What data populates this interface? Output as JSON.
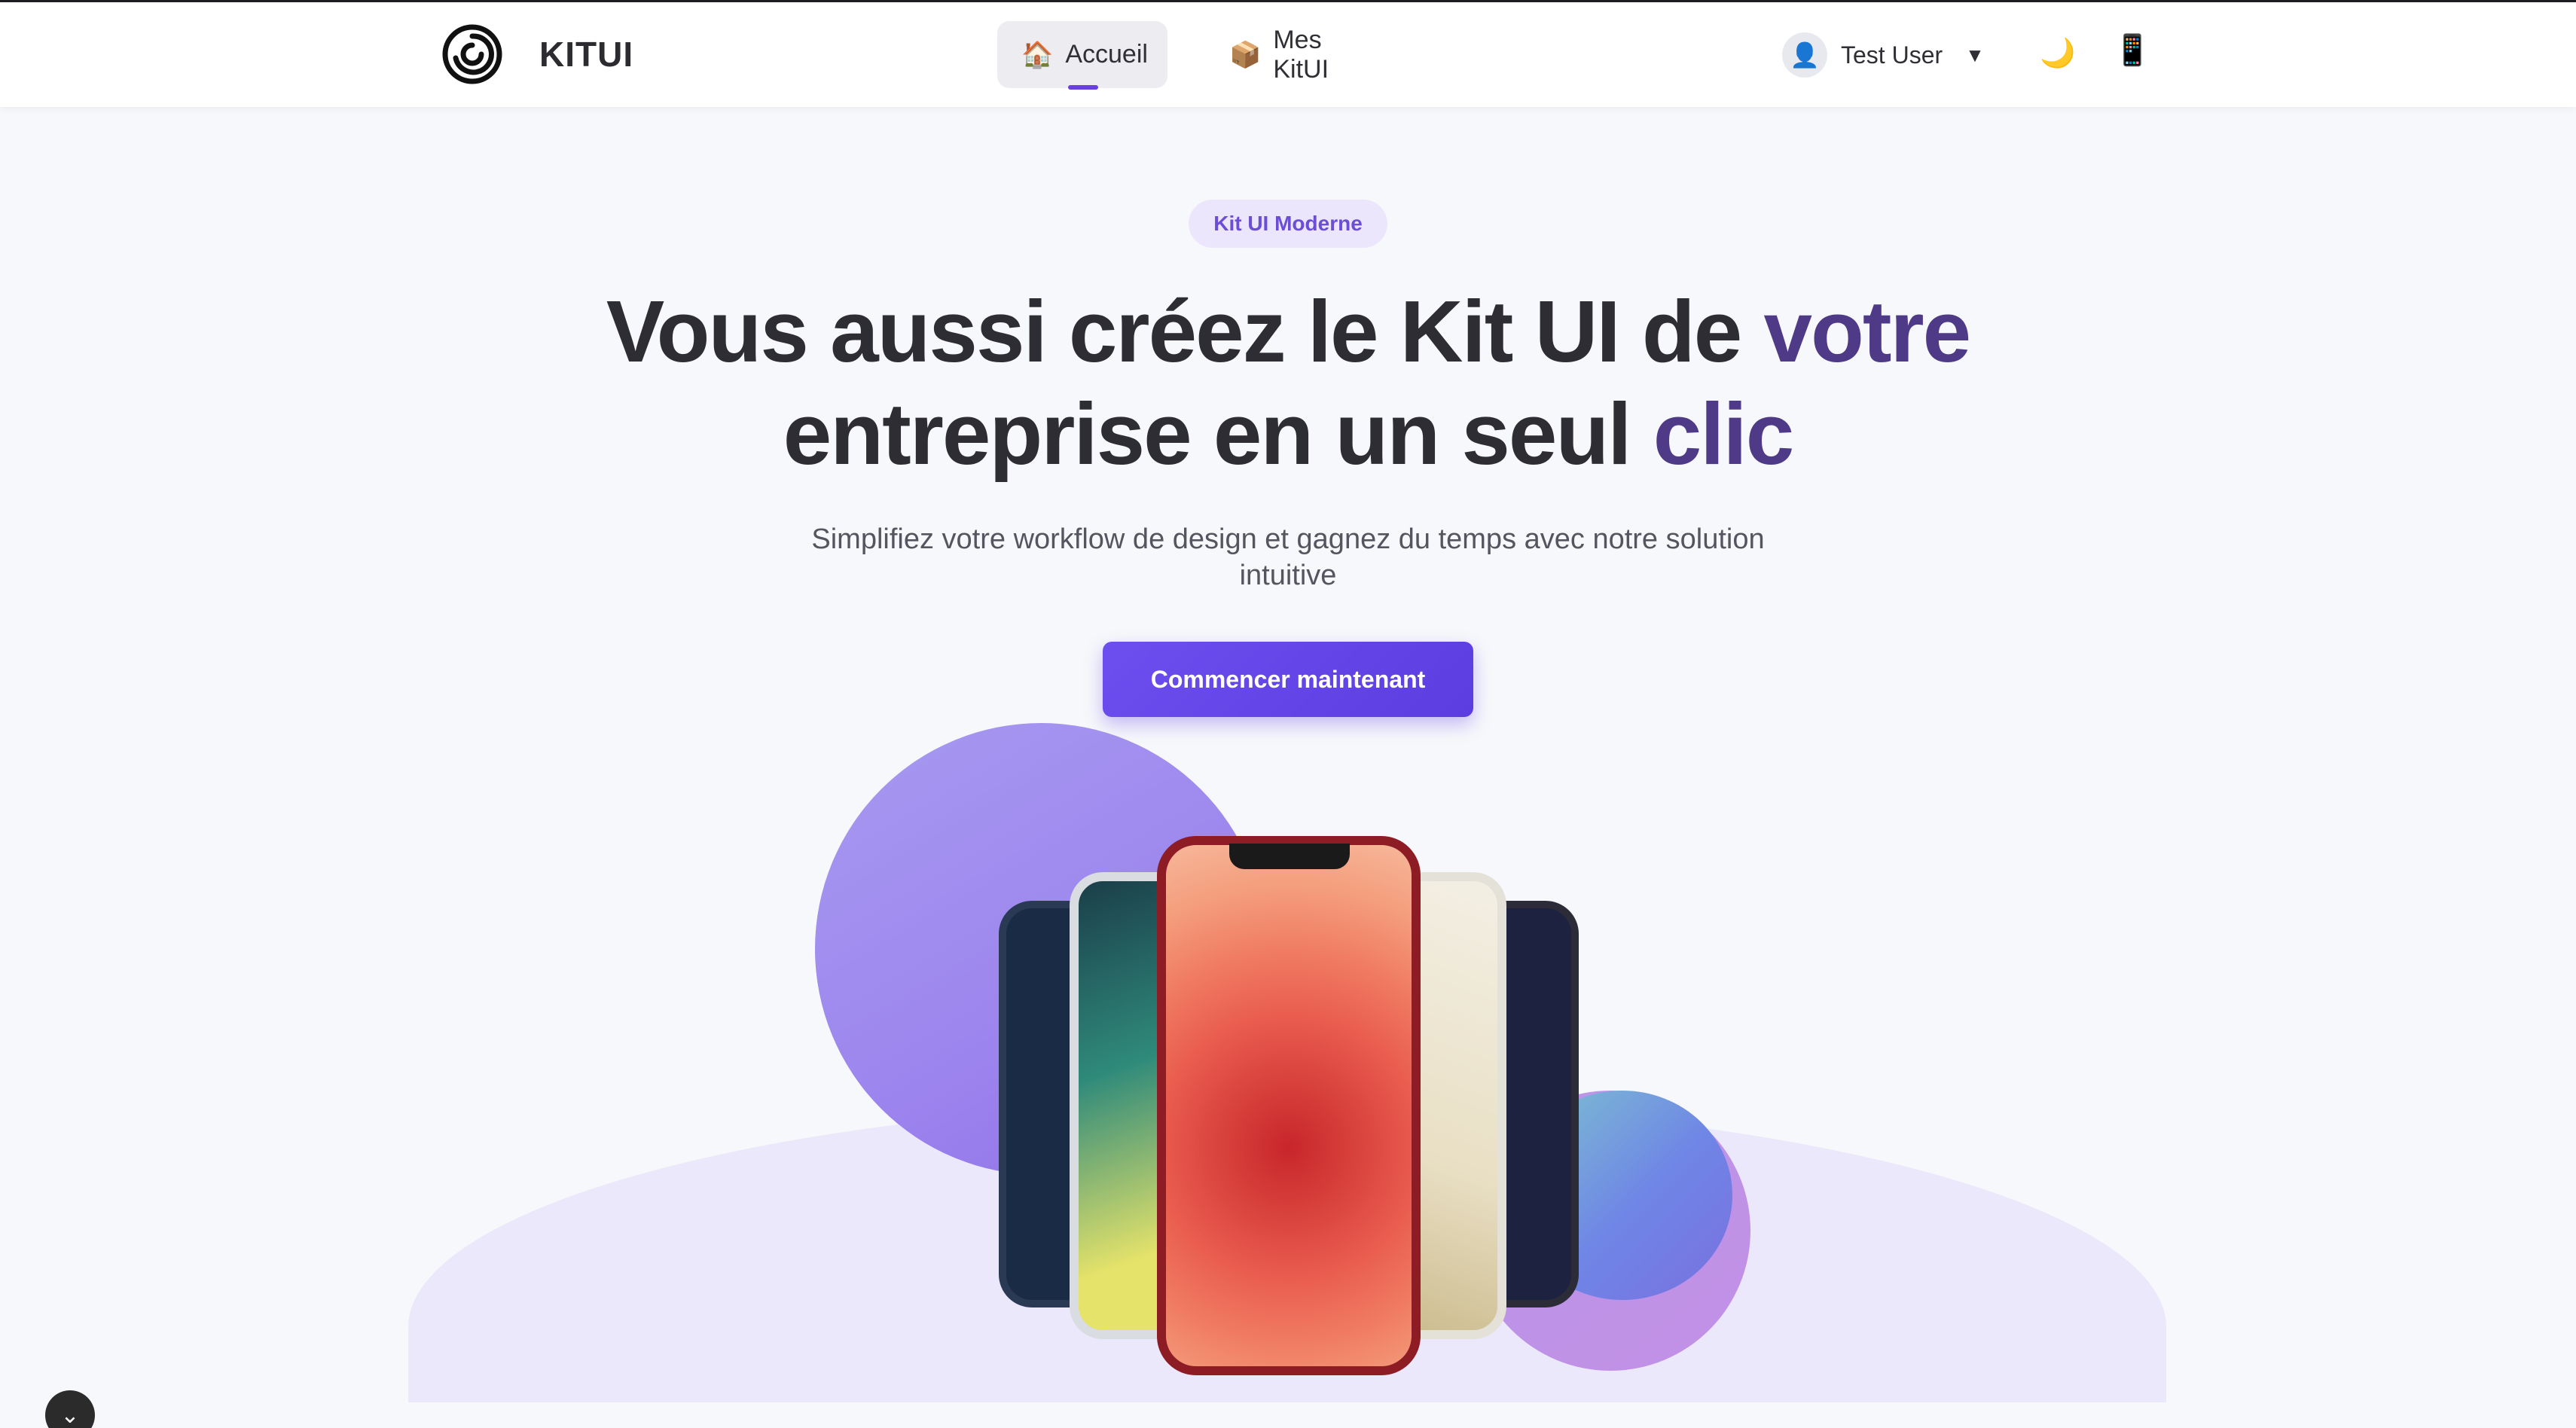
{
  "header": {
    "brand": "KITUI",
    "nav": [
      {
        "label": "Accueil",
        "icon": "house-icon",
        "glyph": "🏠"
      },
      {
        "label": "Mes KitUI",
        "icon": "package-icon",
        "glyph": "📦"
      }
    ],
    "user": {
      "name": "Test User",
      "avatar_glyph": "👤",
      "caret": "▼"
    },
    "theme_toggle_glyph": "🌙",
    "device_glyph": "📱"
  },
  "hero": {
    "badge": "Kit UI Moderne",
    "title_part1": "Vous aussi créez le Kit UI de ",
    "title_highlight1": "votre",
    "title_part2": " entreprise en un seul ",
    "title_highlight2": "clic",
    "subtitle": "Simplifiez votre workflow de design et gagnez du temps avec notre solution intuitive",
    "cta": "Commencer maintenant"
  },
  "floating": {
    "scroll_glyph": "⌄"
  },
  "colors": {
    "accent": "#6a3fe0",
    "title_highlight": "#4e3a86",
    "badge_bg": "#ebe6fb"
  }
}
